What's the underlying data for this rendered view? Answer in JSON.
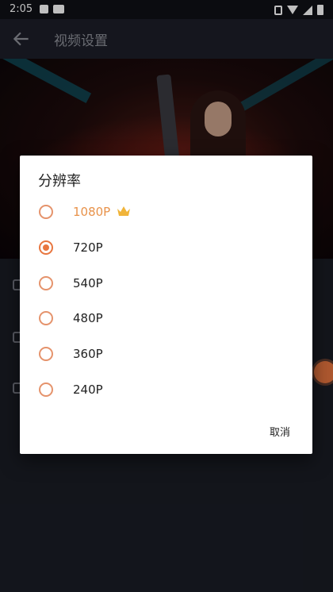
{
  "status_bar": {
    "time": "2:05"
  },
  "app_bar": {
    "title": "视频设置"
  },
  "dialog": {
    "title": "分辨率",
    "options": [
      {
        "label": "1080P",
        "checked": false,
        "premium": true
      },
      {
        "label": "720P",
        "checked": true,
        "premium": false
      },
      {
        "label": "540P",
        "checked": false,
        "premium": false
      },
      {
        "label": "480P",
        "checked": false,
        "premium": false
      },
      {
        "label": "360P",
        "checked": false,
        "premium": false
      },
      {
        "label": "240P",
        "checked": false,
        "premium": false
      }
    ],
    "cancel_label": "取消"
  },
  "colors": {
    "accent": "#e8763f",
    "premium": "#e8924a",
    "background": "#1a1c25"
  }
}
